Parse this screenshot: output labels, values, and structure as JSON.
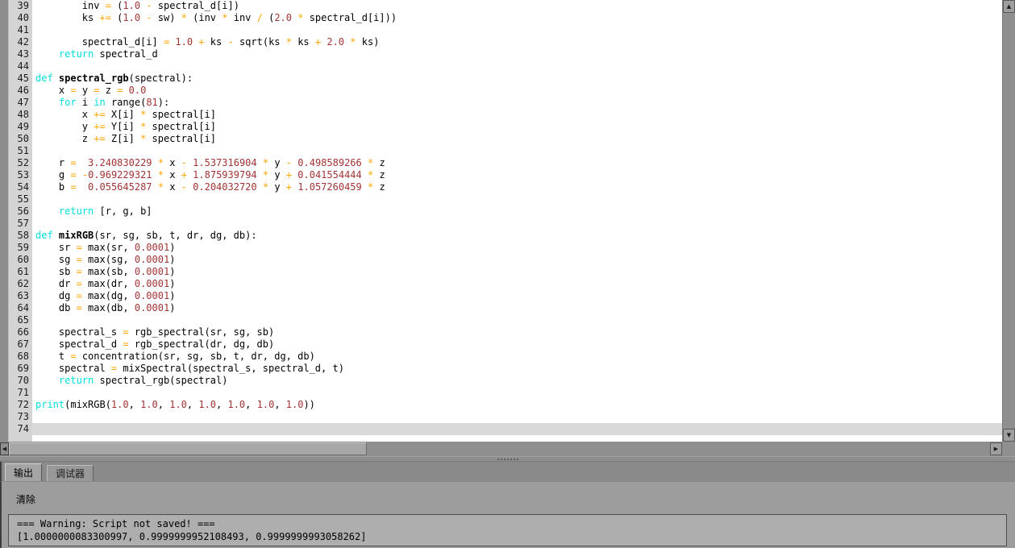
{
  "editor": {
    "current_line": 74,
    "lines": [
      {
        "no": 39,
        "t": [
          [
            "p",
            "        inv "
          ],
          [
            "o",
            "="
          ],
          [
            "p",
            " ("
          ],
          [
            "n",
            "1.0"
          ],
          [
            "p",
            " "
          ],
          [
            "o",
            "-"
          ],
          [
            "p",
            " spectral_d[i])"
          ]
        ]
      },
      {
        "no": 40,
        "t": [
          [
            "p",
            "        ks "
          ],
          [
            "o",
            "+="
          ],
          [
            "p",
            " ("
          ],
          [
            "n",
            "1.0"
          ],
          [
            "p",
            " "
          ],
          [
            "o",
            "-"
          ],
          [
            "p",
            " sw) "
          ],
          [
            "o",
            "*"
          ],
          [
            "p",
            " (inv "
          ],
          [
            "o",
            "*"
          ],
          [
            "p",
            " inv "
          ],
          [
            "o",
            "/"
          ],
          [
            "p",
            " ("
          ],
          [
            "n",
            "2.0"
          ],
          [
            "p",
            " "
          ],
          [
            "o",
            "*"
          ],
          [
            "p",
            " spectral_d[i]))"
          ]
        ]
      },
      {
        "no": 41,
        "t": []
      },
      {
        "no": 42,
        "t": [
          [
            "p",
            "        spectral_d[i] "
          ],
          [
            "o",
            "="
          ],
          [
            "p",
            " "
          ],
          [
            "n",
            "1.0"
          ],
          [
            "p",
            " "
          ],
          [
            "o",
            "+"
          ],
          [
            "p",
            " ks "
          ],
          [
            "o",
            "-"
          ],
          [
            "p",
            " sqrt(ks "
          ],
          [
            "o",
            "*"
          ],
          [
            "p",
            " ks "
          ],
          [
            "o",
            "+"
          ],
          [
            "p",
            " "
          ],
          [
            "n",
            "2.0"
          ],
          [
            "p",
            " "
          ],
          [
            "o",
            "*"
          ],
          [
            "p",
            " ks)"
          ]
        ]
      },
      {
        "no": 43,
        "t": [
          [
            "p",
            "    "
          ],
          [
            "k",
            "return"
          ],
          [
            "p",
            " spectral_d"
          ]
        ]
      },
      {
        "no": 44,
        "t": []
      },
      {
        "no": 45,
        "t": [
          [
            "k",
            "def"
          ],
          [
            "p",
            " "
          ],
          [
            "f",
            "spectral_rgb"
          ],
          [
            "p",
            "(spectral):"
          ]
        ]
      },
      {
        "no": 46,
        "t": [
          [
            "p",
            "    x "
          ],
          [
            "o",
            "="
          ],
          [
            "p",
            " y "
          ],
          [
            "o",
            "="
          ],
          [
            "p",
            " z "
          ],
          [
            "o",
            "="
          ],
          [
            "p",
            " "
          ],
          [
            "n",
            "0.0"
          ]
        ]
      },
      {
        "no": 47,
        "t": [
          [
            "p",
            "    "
          ],
          [
            "k",
            "for"
          ],
          [
            "p",
            " i "
          ],
          [
            "k",
            "in"
          ],
          [
            "p",
            " range("
          ],
          [
            "n",
            "81"
          ],
          [
            "p",
            "):"
          ]
        ]
      },
      {
        "no": 48,
        "t": [
          [
            "p",
            "        x "
          ],
          [
            "o",
            "+="
          ],
          [
            "p",
            " X[i] "
          ],
          [
            "o",
            "*"
          ],
          [
            "p",
            " spectral[i]"
          ]
        ]
      },
      {
        "no": 49,
        "t": [
          [
            "p",
            "        y "
          ],
          [
            "o",
            "+="
          ],
          [
            "p",
            " Y[i] "
          ],
          [
            "o",
            "*"
          ],
          [
            "p",
            " spectral[i]"
          ]
        ]
      },
      {
        "no": 50,
        "t": [
          [
            "p",
            "        z "
          ],
          [
            "o",
            "+="
          ],
          [
            "p",
            " Z[i] "
          ],
          [
            "o",
            "*"
          ],
          [
            "p",
            " spectral[i]"
          ]
        ]
      },
      {
        "no": 51,
        "t": []
      },
      {
        "no": 52,
        "t": [
          [
            "p",
            "    r "
          ],
          [
            "o",
            "="
          ],
          [
            "p",
            "  "
          ],
          [
            "n",
            "3.240830229"
          ],
          [
            "p",
            " "
          ],
          [
            "o",
            "*"
          ],
          [
            "p",
            " x "
          ],
          [
            "o",
            "-"
          ],
          [
            "p",
            " "
          ],
          [
            "n",
            "1.537316904"
          ],
          [
            "p",
            " "
          ],
          [
            "o",
            "*"
          ],
          [
            "p",
            " y "
          ],
          [
            "o",
            "-"
          ],
          [
            "p",
            " "
          ],
          [
            "n",
            "0.498589266"
          ],
          [
            "p",
            " "
          ],
          [
            "o",
            "*"
          ],
          [
            "p",
            " z"
          ]
        ]
      },
      {
        "no": 53,
        "t": [
          [
            "p",
            "    g "
          ],
          [
            "o",
            "="
          ],
          [
            "p",
            " "
          ],
          [
            "o",
            "-"
          ],
          [
            "n",
            "0.969229321"
          ],
          [
            "p",
            " "
          ],
          [
            "o",
            "*"
          ],
          [
            "p",
            " x "
          ],
          [
            "o",
            "+"
          ],
          [
            "p",
            " "
          ],
          [
            "n",
            "1.875939794"
          ],
          [
            "p",
            " "
          ],
          [
            "o",
            "*"
          ],
          [
            "p",
            " y "
          ],
          [
            "o",
            "+"
          ],
          [
            "p",
            " "
          ],
          [
            "n",
            "0.041554444"
          ],
          [
            "p",
            " "
          ],
          [
            "o",
            "*"
          ],
          [
            "p",
            " z"
          ]
        ]
      },
      {
        "no": 54,
        "t": [
          [
            "p",
            "    b "
          ],
          [
            "o",
            "="
          ],
          [
            "p",
            "  "
          ],
          [
            "n",
            "0.055645287"
          ],
          [
            "p",
            " "
          ],
          [
            "o",
            "*"
          ],
          [
            "p",
            " x "
          ],
          [
            "o",
            "-"
          ],
          [
            "p",
            " "
          ],
          [
            "n",
            "0.204032720"
          ],
          [
            "p",
            " "
          ],
          [
            "o",
            "*"
          ],
          [
            "p",
            " y "
          ],
          [
            "o",
            "+"
          ],
          [
            "p",
            " "
          ],
          [
            "n",
            "1.057260459"
          ],
          [
            "p",
            " "
          ],
          [
            "o",
            "*"
          ],
          [
            "p",
            " z"
          ]
        ]
      },
      {
        "no": 55,
        "t": []
      },
      {
        "no": 56,
        "t": [
          [
            "p",
            "    "
          ],
          [
            "k",
            "return"
          ],
          [
            "p",
            " [r, g, b]"
          ]
        ]
      },
      {
        "no": 57,
        "t": []
      },
      {
        "no": 58,
        "t": [
          [
            "k",
            "def"
          ],
          [
            "p",
            " "
          ],
          [
            "f",
            "mixRGB"
          ],
          [
            "p",
            "(sr, sg, sb, t, dr, dg, db):"
          ]
        ]
      },
      {
        "no": 59,
        "t": [
          [
            "p",
            "    sr "
          ],
          [
            "o",
            "="
          ],
          [
            "p",
            " max(sr, "
          ],
          [
            "n",
            "0.0001"
          ],
          [
            "p",
            ")"
          ]
        ]
      },
      {
        "no": 60,
        "t": [
          [
            "p",
            "    sg "
          ],
          [
            "o",
            "="
          ],
          [
            "p",
            " max(sg, "
          ],
          [
            "n",
            "0.0001"
          ],
          [
            "p",
            ")"
          ]
        ]
      },
      {
        "no": 61,
        "t": [
          [
            "p",
            "    sb "
          ],
          [
            "o",
            "="
          ],
          [
            "p",
            " max(sb, "
          ],
          [
            "n",
            "0.0001"
          ],
          [
            "p",
            ")"
          ]
        ]
      },
      {
        "no": 62,
        "t": [
          [
            "p",
            "    dr "
          ],
          [
            "o",
            "="
          ],
          [
            "p",
            " max(dr, "
          ],
          [
            "n",
            "0.0001"
          ],
          [
            "p",
            ")"
          ]
        ]
      },
      {
        "no": 63,
        "t": [
          [
            "p",
            "    dg "
          ],
          [
            "o",
            "="
          ],
          [
            "p",
            " max(dg, "
          ],
          [
            "n",
            "0.0001"
          ],
          [
            "p",
            ")"
          ]
        ]
      },
      {
        "no": 64,
        "t": [
          [
            "p",
            "    db "
          ],
          [
            "o",
            "="
          ],
          [
            "p",
            " max(db, "
          ],
          [
            "n",
            "0.0001"
          ],
          [
            "p",
            ")"
          ]
        ]
      },
      {
        "no": 65,
        "t": []
      },
      {
        "no": 66,
        "t": [
          [
            "p",
            "    spectral_s "
          ],
          [
            "o",
            "="
          ],
          [
            "p",
            " rgb_spectral(sr, sg, sb)"
          ]
        ]
      },
      {
        "no": 67,
        "t": [
          [
            "p",
            "    spectral_d "
          ],
          [
            "o",
            "="
          ],
          [
            "p",
            " rgb_spectral(dr, dg, db)"
          ]
        ]
      },
      {
        "no": 68,
        "t": [
          [
            "p",
            "    t "
          ],
          [
            "o",
            "="
          ],
          [
            "p",
            " concentration(sr, sg, sb, t, dr, dg, db)"
          ]
        ]
      },
      {
        "no": 69,
        "t": [
          [
            "p",
            "    spectral "
          ],
          [
            "o",
            "="
          ],
          [
            "p",
            " mixSpectral(spectral_s, spectral_d, t)"
          ]
        ]
      },
      {
        "no": 70,
        "t": [
          [
            "p",
            "    "
          ],
          [
            "k",
            "return"
          ],
          [
            "p",
            " spectral_rgb(spectral)"
          ]
        ]
      },
      {
        "no": 71,
        "t": []
      },
      {
        "no": 72,
        "t": [
          [
            "k",
            "print"
          ],
          [
            "p",
            "(mixRGB("
          ],
          [
            "n",
            "1.0"
          ],
          [
            "p",
            ", "
          ],
          [
            "n",
            "1.0"
          ],
          [
            "p",
            ", "
          ],
          [
            "n",
            "1.0"
          ],
          [
            "p",
            ", "
          ],
          [
            "n",
            "1.0"
          ],
          [
            "p",
            ", "
          ],
          [
            "n",
            "1.0"
          ],
          [
            "p",
            ", "
          ],
          [
            "n",
            "1.0"
          ],
          [
            "p",
            ", "
          ],
          [
            "n",
            "1.0"
          ],
          [
            "p",
            "))"
          ]
        ]
      },
      {
        "no": 73,
        "t": []
      },
      {
        "no": 74,
        "t": []
      }
    ]
  },
  "icons": {
    "up": "▲",
    "down": "▼",
    "left": "◀",
    "right": "▶"
  },
  "panel": {
    "tabs": [
      {
        "id": "output",
        "label": "输出",
        "active": true
      },
      {
        "id": "debugger",
        "label": "调试器",
        "active": false
      }
    ],
    "clear_label": "清除",
    "output_lines": [
      "=== Warning: Script not saved! ===",
      "[1.0000000083300997, 0.9999999952108493, 0.9999999993058262]"
    ]
  },
  "colors": {
    "keyword": "#00dede",
    "number": "#a23434",
    "operator": "#ffa500",
    "plain_text": "#000000",
    "editor_bg": "#ffffff",
    "gutter_bg": "#d4d4d4",
    "fold_strip": "#8d8d8d",
    "current_line_bg": "#d9d9d9",
    "chrome_gray": "#8e8e8e",
    "panel_bg": "#9d9d9d",
    "console_bg": "#aeaeae",
    "console_border": "#4d4d4d"
  }
}
